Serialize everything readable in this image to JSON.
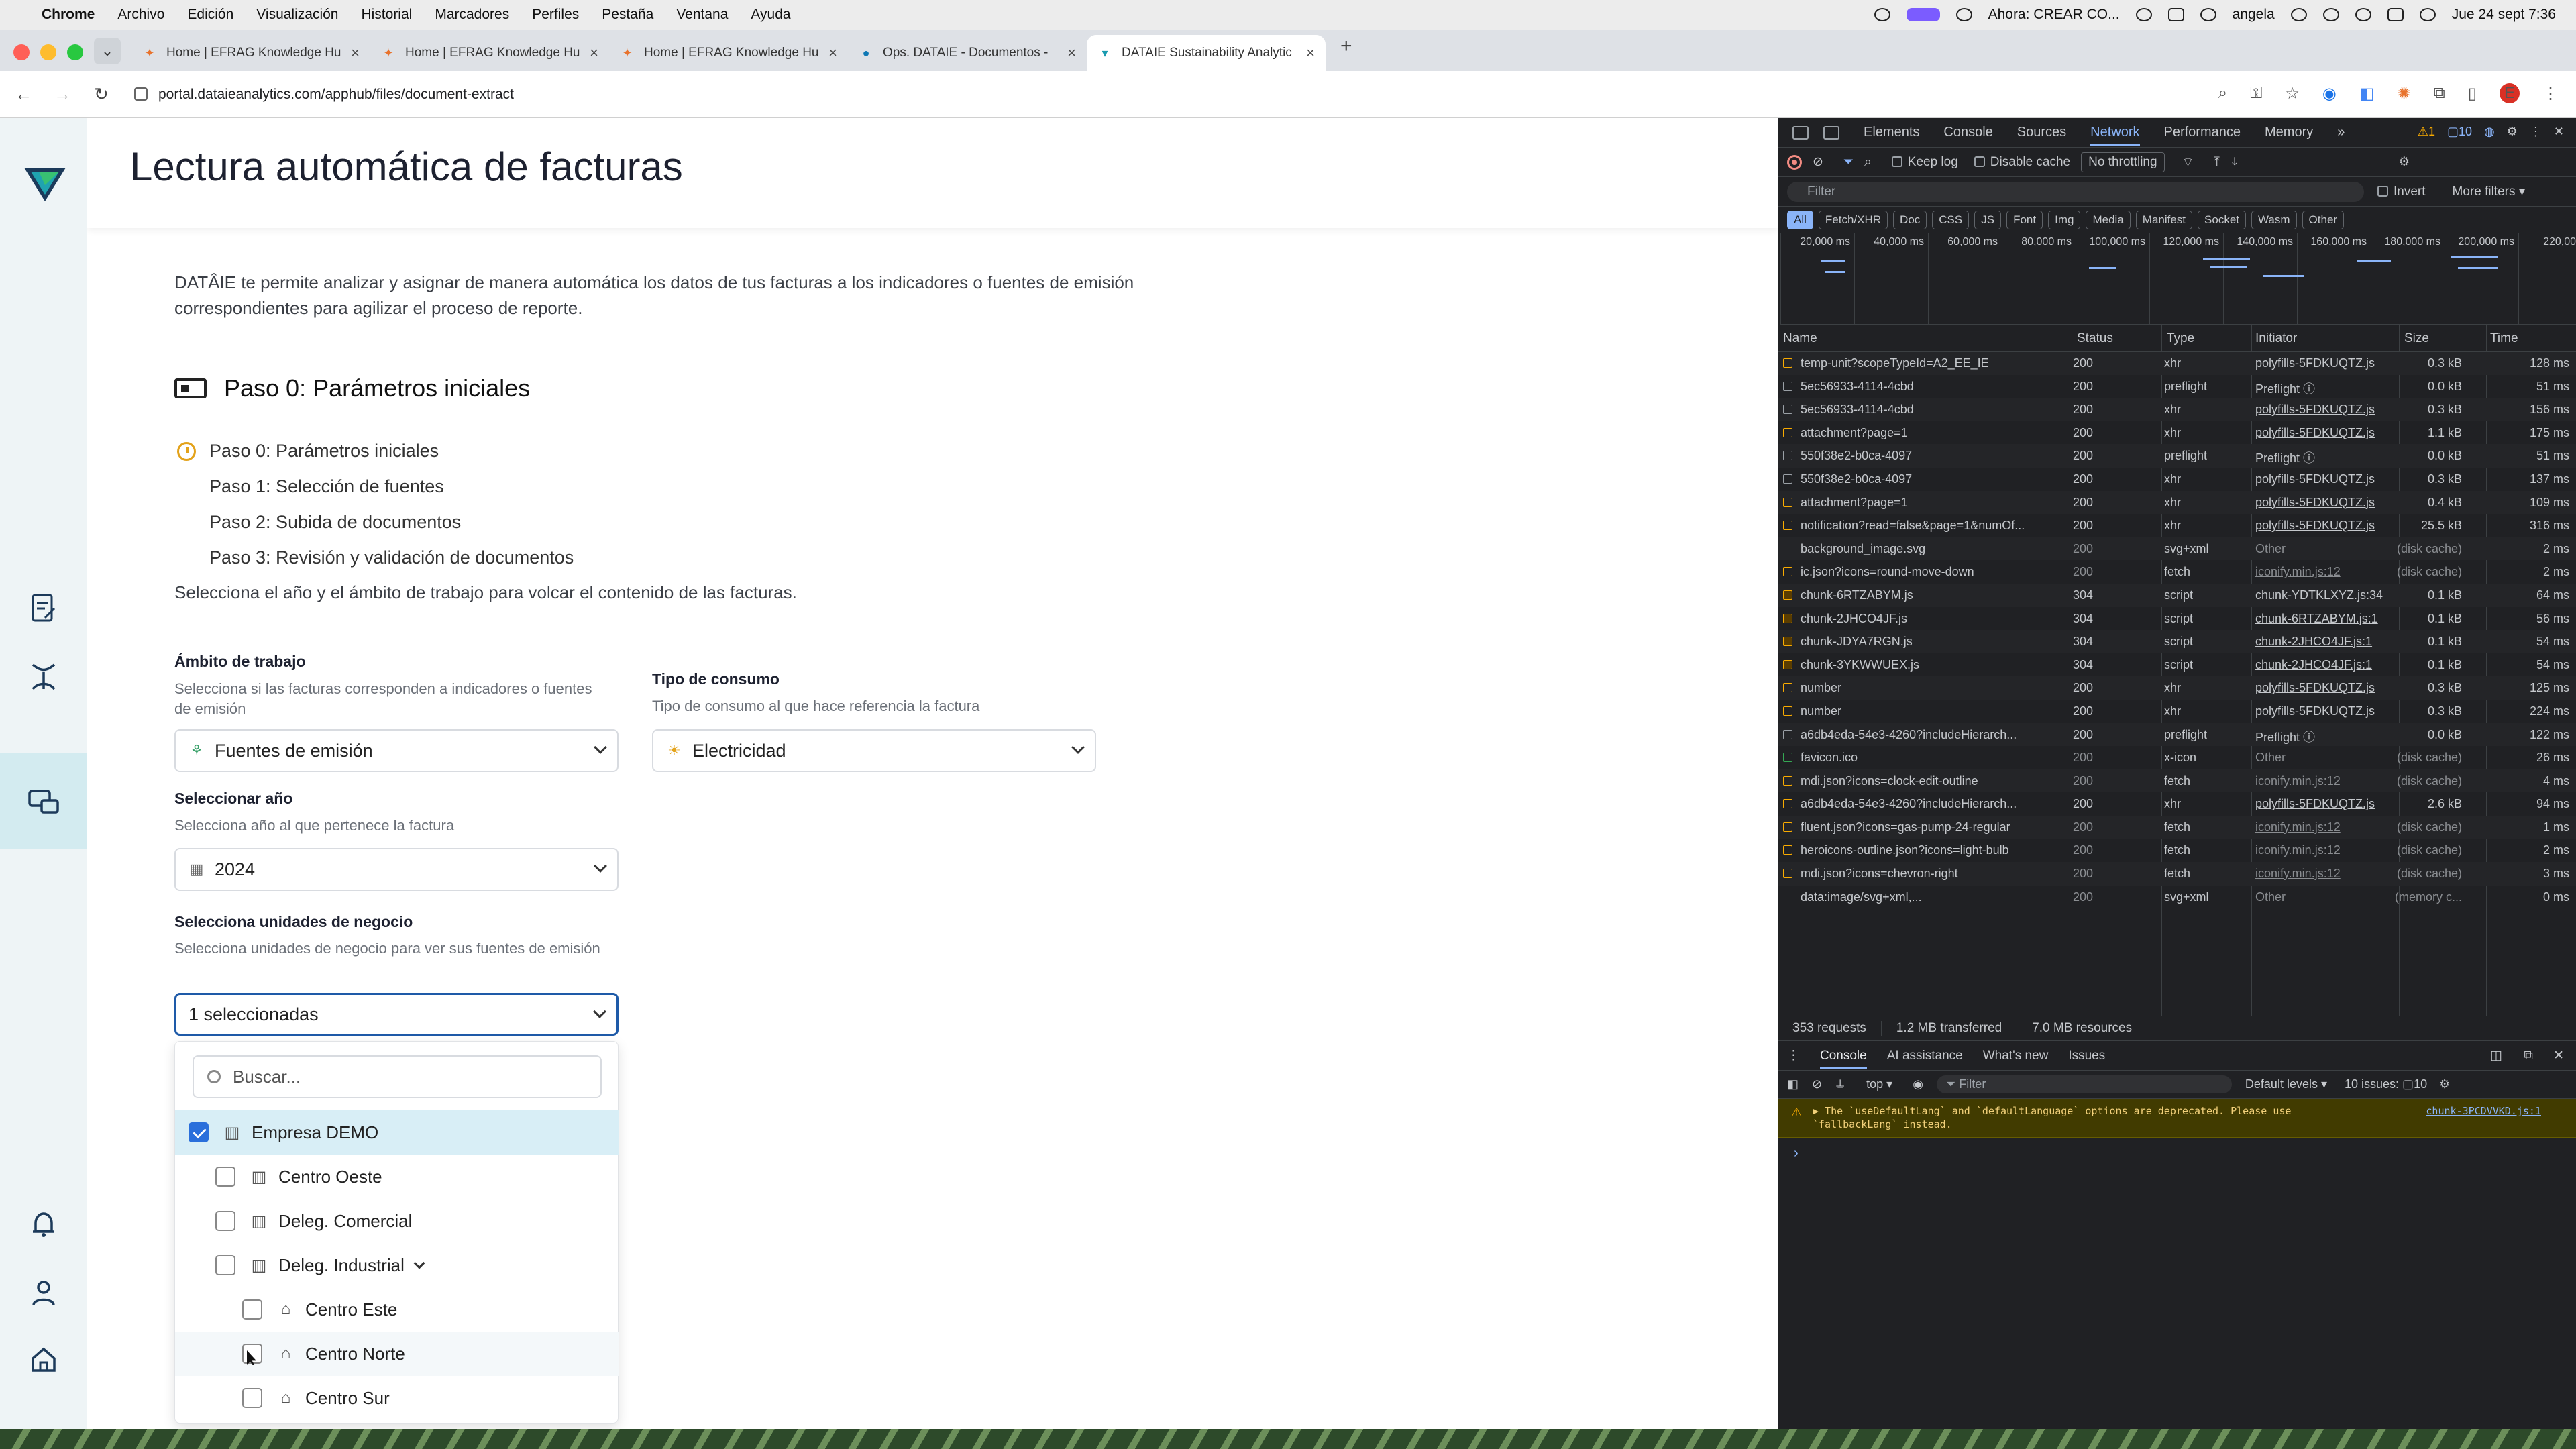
{
  "menubar": {
    "app": "Chrome",
    "items": [
      "Archivo",
      "Edición",
      "Visualización",
      "Historial",
      "Marcadores",
      "Perfiles",
      "Pestaña",
      "Ventana",
      "Ayuda"
    ],
    "status_now": "Ahora: CREAR CO...",
    "user": "angela",
    "datetime": "Jue 24 sept 7:36"
  },
  "tabs": [
    {
      "label": "Home | EFRAG Knowledge Hu",
      "icon": "efrag-icon",
      "active": false
    },
    {
      "label": "Home | EFRAG Knowledge Hu",
      "icon": "efrag-icon",
      "active": false
    },
    {
      "label": "Home | EFRAG Knowledge Hu",
      "icon": "efrag-icon",
      "active": false
    },
    {
      "label": "Ops. DATAIE - Documentos -",
      "icon": "sharepoint-icon",
      "active": false
    },
    {
      "label": "DATAIE Sustainability Analytic",
      "icon": "dataie-icon",
      "active": true
    }
  ],
  "address": {
    "url": "portal.dataieanalytics.com/apphub/files/document-extract"
  },
  "page": {
    "title": "Lectura automática de facturas",
    "intro": "DATÂIE te permite analizar y asignar de manera automática los datos de tus facturas a los indicadores o fuentes de emisión correspondientes para agilizar el proceso de reporte.",
    "step_title": "Paso 0: Parámetros iniciales",
    "steps": [
      "Paso 0: Parámetros iniciales",
      "Paso 1: Selección de fuentes",
      "Paso 2: Subida de documentos",
      "Paso 3: Revisión y validación de documentos"
    ],
    "description": "Selecciona el año y el ámbito de trabajo para volcar el contenido de las facturas.",
    "ambito": {
      "label": "Ámbito de trabajo",
      "hint": "Selecciona si las facturas corresponden a indicadores o fuentes de emisión",
      "value": "Fuentes de emisión"
    },
    "consumo": {
      "label": "Tipo de consumo",
      "hint": "Tipo de consumo al que hace referencia la factura",
      "value": "Electricidad"
    },
    "anio": {
      "label": "Seleccionar año",
      "hint": "Selecciona año al que pertenece la factura",
      "value": "2024"
    },
    "unidades": {
      "label": "Selecciona unidades de negocio",
      "hint": "Selecciona unidades de negocio para ver sus fuentes de emisión",
      "value": "1 seleccionadas",
      "search_placeholder": "Buscar...",
      "items": [
        {
          "label": "Empresa DEMO",
          "checked": true
        },
        {
          "label": "Centro Oeste",
          "checked": false
        },
        {
          "label": "Deleg. Comercial",
          "checked": false
        },
        {
          "label": "Deleg. Industrial",
          "checked": false
        },
        {
          "label": "Centro Este",
          "checked": false
        },
        {
          "label": "Centro Norte",
          "checked": false
        },
        {
          "label": "Centro Sur",
          "checked": false
        }
      ]
    }
  },
  "devtools": {
    "tabs": [
      "Elements",
      "Console",
      "Sources",
      "Network",
      "Performance",
      "Memory"
    ],
    "warn_count": "1",
    "issue_count": "10",
    "keep_log": "Keep log",
    "disable_cache": "Disable cache",
    "throttling": "No throttling",
    "filter_placeholder": "Filter",
    "invert": "Invert",
    "more_filters": "More filters",
    "types": [
      "All",
      "Fetch/XHR",
      "Doc",
      "CSS",
      "JS",
      "Font",
      "Img",
      "Media",
      "Manifest",
      "Socket",
      "Wasm",
      "Other"
    ],
    "timeline_ticks": [
      "20,000 ms",
      "40,000 ms",
      "60,000 ms",
      "80,000 ms",
      "100,000 ms",
      "120,000 ms",
      "140,000 ms",
      "160,000 ms",
      "180,000 ms",
      "200,000 ms",
      "220,00"
    ],
    "columns": [
      "Name",
      "Status",
      "Type",
      "Initiator",
      "Size",
      "Time"
    ],
    "rows": [
      [
        "temp-unit?scopeTypeId=A2_EE_IE",
        "200",
        "xhr",
        "polyfills-5FDKUQTZ.js",
        "0.3 kB",
        "128 ms"
      ],
      [
        "5ec56933-4114-4cbd",
        "200",
        "preflight",
        "Preflight ⓘ",
        "0.0 kB",
        "51 ms"
      ],
      [
        "5ec56933-4114-4cbd",
        "200",
        "xhr",
        "polyfills-5FDKUQTZ.js",
        "0.3 kB",
        "156 ms"
      ],
      [
        "attachment?page=1",
        "200",
        "xhr",
        "polyfills-5FDKUQTZ.js",
        "1.1 kB",
        "175 ms"
      ],
      [
        "550f38e2-b0ca-4097",
        "200",
        "preflight",
        "Preflight ⓘ",
        "0.0 kB",
        "51 ms"
      ],
      [
        "550f38e2-b0ca-4097",
        "200",
        "xhr",
        "polyfills-5FDKUQTZ.js",
        "0.3 kB",
        "137 ms"
      ],
      [
        "attachment?page=1",
        "200",
        "xhr",
        "polyfills-5FDKUQTZ.js",
        "0.4 kB",
        "109 ms"
      ],
      [
        "notification?read=false&page=1&numOf...",
        "200",
        "xhr",
        "polyfills-5FDKUQTZ.js",
        "25.5 kB",
        "316 ms"
      ],
      [
        "background_image.svg",
        "200",
        "svg+xml",
        "Other",
        "(disk cache)",
        "2 ms"
      ],
      [
        "ic.json?icons=round-move-down",
        "200",
        "fetch",
        "iconify.min.js:12",
        "(disk cache)",
        "2 ms"
      ],
      [
        "chunk-6RTZABYM.js",
        "304",
        "script",
        "chunk-YDTKLXYZ.js:34",
        "0.1 kB",
        "64 ms"
      ],
      [
        "chunk-2JHCO4JF.js",
        "304",
        "script",
        "chunk-6RTZABYM.js:1",
        "0.1 kB",
        "56 ms"
      ],
      [
        "chunk-JDYA7RGN.js",
        "304",
        "script",
        "chunk-2JHCO4JF.js:1",
        "0.1 kB",
        "54 ms"
      ],
      [
        "chunk-3YKWWUEX.js",
        "304",
        "script",
        "chunk-2JHCO4JF.js:1",
        "0.1 kB",
        "54 ms"
      ],
      [
        "number",
        "200",
        "xhr",
        "polyfills-5FDKUQTZ.js",
        "0.3 kB",
        "125 ms"
      ],
      [
        "number",
        "200",
        "xhr",
        "polyfills-5FDKUQTZ.js",
        "0.3 kB",
        "224 ms"
      ],
      [
        "a6db4eda-54e3-4260?includeHierarch...",
        "200",
        "preflight",
        "Preflight ⓘ",
        "0.0 kB",
        "122 ms"
      ],
      [
        "favicon.ico",
        "200",
        "x-icon",
        "Other",
        "(disk cache)",
        "26 ms"
      ],
      [
        "mdi.json?icons=clock-edit-outline",
        "200",
        "fetch",
        "iconify.min.js:12",
        "(disk cache)",
        "4 ms"
      ],
      [
        "a6db4eda-54e3-4260?includeHierarch...",
        "200",
        "xhr",
        "polyfills-5FDKUQTZ.js",
        "2.6 kB",
        "94 ms"
      ],
      [
        "fluent.json?icons=gas-pump-24-regular",
        "200",
        "fetch",
        "iconify.min.js:12",
        "(disk cache)",
        "1 ms"
      ],
      [
        "heroicons-outline.json?icons=light-bulb",
        "200",
        "fetch",
        "iconify.min.js:12",
        "(disk cache)",
        "2 ms"
      ],
      [
        "mdi.json?icons=chevron-right",
        "200",
        "fetch",
        "iconify.min.js:12",
        "(disk cache)",
        "3 ms"
      ],
      [
        "data:image/svg+xml,...",
        "200",
        "svg+xml",
        "Other",
        "(memory c...",
        "0 ms"
      ]
    ],
    "summary": [
      "353 requests",
      "1.2 MB transferred",
      "7.0 MB resources"
    ],
    "drawer_tabs": [
      "Console",
      "AI assistance",
      "What's new",
      "Issues"
    ],
    "context": "top",
    "console_filter": "Filter",
    "levels": "Default levels",
    "issues": "10 issues: ▢10",
    "warning_line1": "▶ The `useDefaultLang` and `defaultLanguage` options are deprecated. Please use",
    "warning_line2": "`fallbackLang` instead.",
    "warning_source": "chunk-3PCDVVKD.js:1"
  },
  "colors": {
    "accent_blue": "#1e5aa8",
    "checkbox_blue": "#2a6fdb",
    "nav_active": "#d3ebf0",
    "devtools_bg": "#202124",
    "step_clock": "#e3a21a"
  }
}
